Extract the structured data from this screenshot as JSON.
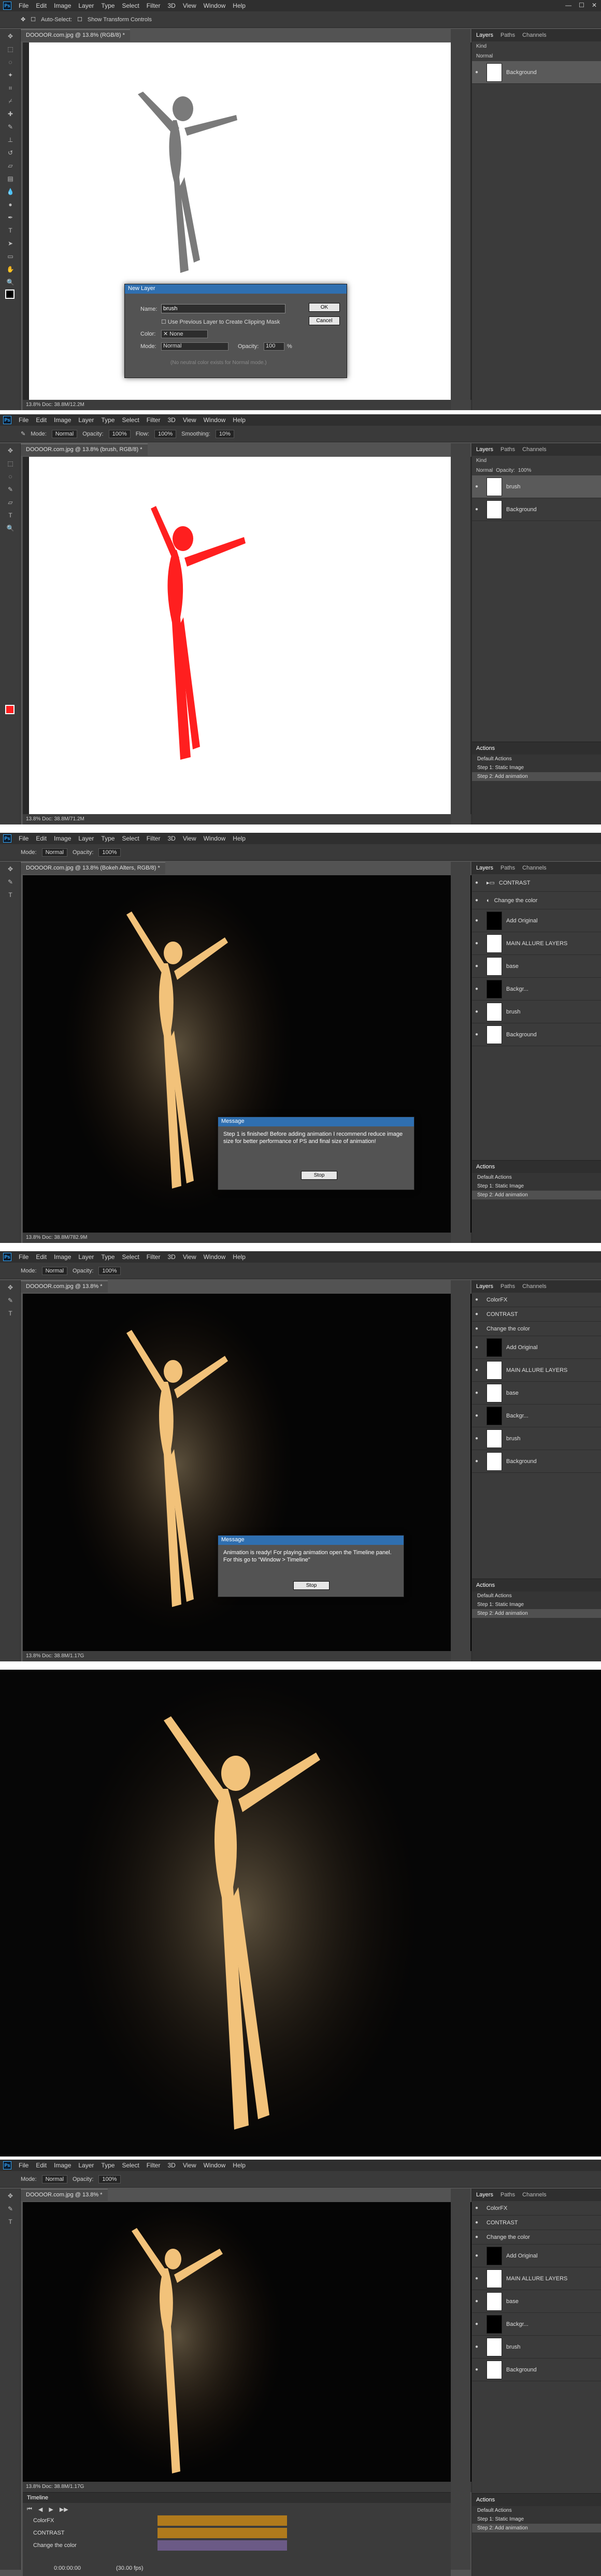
{
  "menu": {
    "ps_logo": "Ps",
    "items": [
      "File",
      "Edit",
      "Image",
      "Layer",
      "Type",
      "Select",
      "Filter",
      "3D",
      "View",
      "Window",
      "Help"
    ]
  },
  "shot1": {
    "options": {
      "auto_select": "Auto-Select:",
      "show_transform": "Show Transform Controls"
    },
    "doc_tab": "DOOOOR.com.jpg @ 13.8% (RGB/8) *",
    "status": "13.8%     Doc: 38.8M/12.2M",
    "dialog": {
      "title": "New Layer",
      "name_label": "Name:",
      "name_value": "brush",
      "clip_label": "Use Previous Layer to Create Clipping Mask",
      "color_label": "Color:",
      "color_value": "None",
      "mode_label": "Mode:",
      "mode_value": "Normal",
      "opacity_label": "Opacity:",
      "opacity_value": "100",
      "opacity_unit": "%",
      "neutral_label": "(No neutral color exists for Normal mode.)",
      "ok": "OK",
      "cancel": "Cancel"
    },
    "layers": [
      {
        "name": "Background"
      }
    ]
  },
  "shot2": {
    "options": {
      "mode_label": "Mode:",
      "mode_value": "Normal",
      "opacity_label": "Opacity:",
      "opacity_value": "100%",
      "flow_label": "Flow:",
      "flow_value": "100%",
      "smoothing_label": "Smoothing:",
      "smoothing_value": "10%"
    },
    "doc_tab": "DOOOOR.com.jpg @ 13.8% (brush, RGB/8) *",
    "status": "13.8%     Doc: 38.8M/71.2M",
    "layers": [
      {
        "name": "brush"
      },
      {
        "name": "Background"
      }
    ],
    "actions": [
      {
        "name": "Default Actions"
      },
      {
        "name": "Step 1: Static Image"
      },
      {
        "name": "Step 2: Add animation"
      }
    ]
  },
  "shot3": {
    "doc_tab": "DOOOOR.com.jpg @ 13.8% (Bokeh Alters, RGB/8) *",
    "status": "13.8%     Doc: 38.8M/782.9M",
    "dialog": {
      "title": "Message",
      "text": "Step 1 is finished! Before adding animation I recommend reduce image size for better performance of PS and final size of animation!",
      "button": "Stop"
    },
    "layers": [
      {
        "name": "CONTRAST"
      },
      {
        "name": "Change the color"
      },
      {
        "name": "Add Original"
      },
      {
        "name": "MAIN ALLURE LAYERS"
      },
      {
        "name": "base"
      },
      {
        "name": "Backgr..."
      },
      {
        "name": "brush"
      },
      {
        "name": "Background"
      }
    ],
    "actions": [
      {
        "name": "Default Actions"
      },
      {
        "name": "Step 1: Static Image"
      },
      {
        "name": "Step 2: Add animation"
      }
    ]
  },
  "shot4": {
    "doc_tab": "DOOOOR.com.jpg @ 13.8% *",
    "status": "13.8%     Doc: 38.8M/1.17G",
    "dialog": {
      "title": "Message",
      "text": "Animation is ready! For playing animation open the Timeline panel. For this go to \"Window > Timeline\"",
      "button": "Stop"
    },
    "layers": [
      {
        "name": "ColorFX"
      },
      {
        "name": "CONTRAST"
      },
      {
        "name": "Change the color"
      },
      {
        "name": "Add Original"
      },
      {
        "name": "MAIN ALLURE LAYERS"
      },
      {
        "name": "base"
      },
      {
        "name": "Backgr..."
      },
      {
        "name": "brush"
      },
      {
        "name": "Background"
      }
    ],
    "actions": [
      {
        "name": "Default Actions"
      },
      {
        "name": "Step 1: Static Image"
      },
      {
        "name": "Step 2: Add animation"
      }
    ]
  },
  "shot6": {
    "doc_tab": "DOOOOR.com.jpg @ 13.8% *",
    "status": "13.8%     Doc: 38.8M/1.17G",
    "timeline": {
      "title": "Timeline",
      "tracks": [
        {
          "name": "ColorFX"
        },
        {
          "name": "CONTRAST"
        },
        {
          "name": "Change the color"
        }
      ],
      "time": "0:00:00:00",
      "fps": "(30.00 fps)"
    },
    "layers": [
      {
        "name": "ColorFX"
      },
      {
        "name": "CONTRAST"
      },
      {
        "name": "Change the color"
      },
      {
        "name": "Add Original"
      },
      {
        "name": "MAIN ALLURE LAYERS"
      },
      {
        "name": "base"
      },
      {
        "name": "Backgr..."
      },
      {
        "name": "brush"
      },
      {
        "name": "Background"
      }
    ],
    "actions": [
      {
        "name": "Default Actions"
      },
      {
        "name": "Step 1: Static Image"
      },
      {
        "name": "Step 2: Add animation"
      }
    ]
  },
  "panels": {
    "layers_tab": "Layers",
    "paths_tab": "Paths",
    "channels_tab": "Channels",
    "kind": "Kind",
    "mode": "Normal",
    "opacity_label": "Opacity:",
    "opacity_value": "100%",
    "fill_label": "Fill:",
    "fill_value": "100%",
    "actions_tab": "Actions"
  },
  "colors": {
    "accent_blue": "#31a8ff",
    "panel": "#535353",
    "red_fill": "#ff1f1f",
    "fire": "#f2c27a"
  }
}
